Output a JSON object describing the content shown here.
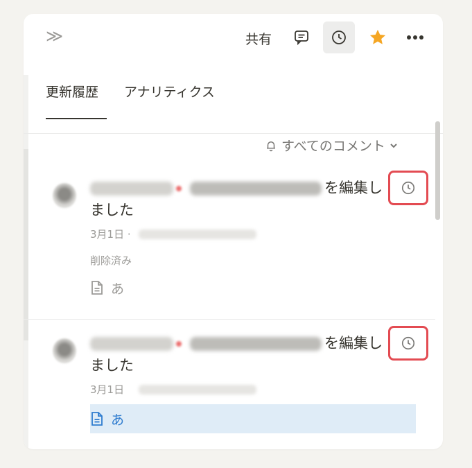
{
  "topbar": {
    "expand_icon": "double-chevron-right-icon",
    "share_label": "共有"
  },
  "tabs": [
    {
      "label": "更新履歴",
      "active": true
    },
    {
      "label": "アナリティクス",
      "active": false
    }
  ],
  "filter": {
    "label": "すべてのコメント",
    "icon": "bell-icon"
  },
  "entries": [
    {
      "action_line1": "を編集し",
      "action_line2": "ました",
      "date": "3月1日 ·",
      "status": "削除済み",
      "page_title": "あ"
    },
    {
      "action_line1": "を編集し",
      "action_line2": "ました",
      "date": "3月1日",
      "page_title": "あ"
    }
  ],
  "colors": {
    "highlight_red": "#e34b52",
    "star": "#f5a623",
    "selected_bg": "#dfecf7",
    "link_blue": "#2f7ccf"
  }
}
